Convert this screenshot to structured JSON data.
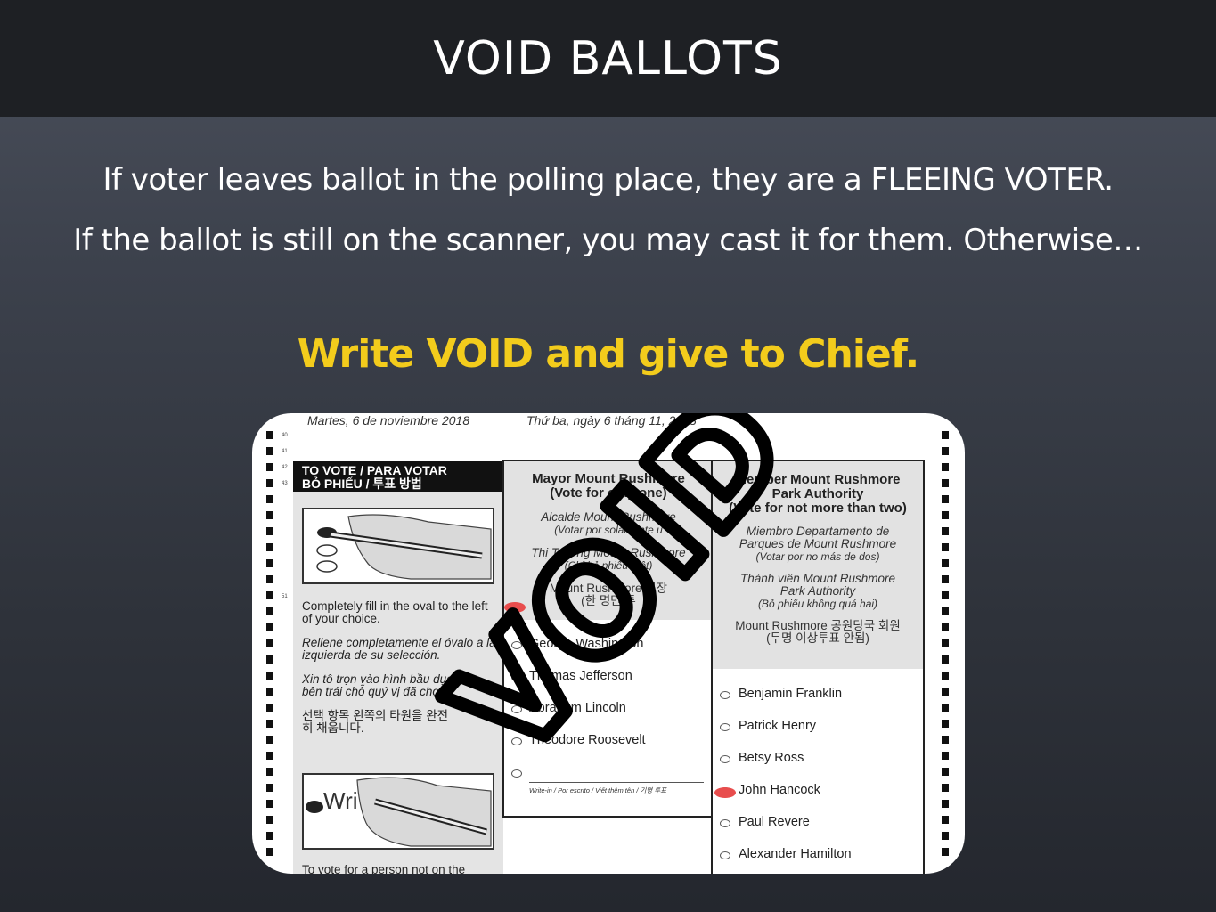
{
  "slide": {
    "title": "VOID BALLOTS",
    "line1": "If voter leaves ballot in the polling place, they are a FLEEING VOTER.",
    "line2": "If the ballot is still on the scanner, you may cast it for them. Otherwise…",
    "callout": "Write VOID and give to Chief.",
    "callout_color": "#f3cc1c"
  },
  "ballot": {
    "date_es": "Martes, 6 de noviembre 2018",
    "date_vi": "Thứ ba, ngày 6 tháng 11, 2018",
    "line_numbers": [
      "40",
      "41",
      "42",
      "43",
      "51"
    ],
    "instructions": {
      "header_line1": "TO VOTE / PARA VOTAR",
      "header_line2": "BỎ PHIẾU / 투표 방법",
      "en": "Completely fill in the oval to the left of your choice.",
      "es": "Rellene completamente el óvalo a la izquierda de su selección.",
      "vi": "Xin tô trọn vào hình bầu dục nằm bên trái chỗ quý vị đã chọ",
      "ko": "선택 항목 왼쪽의 타원을 완전히 채웁니다.",
      "writein_illustration_text": "Wri",
      "footer": "To vote for a person not on the"
    },
    "mayor": {
      "title": "Mayor Mount Rushmore",
      "instruction": "(Vote for only one)",
      "title_es": "Alcalde Mount Rushmore",
      "instruction_es": "(Votar por solamente u",
      "title_vi": "Thị Trưởng Mount Rushmore",
      "instruction_vi": "(Chỉ bỏ phiếu một)",
      "title_ko": "Mount Rushmore 시장",
      "instruction_ko": "(한 명만 투",
      "candidates": [
        "George Washington",
        "Thomas Jefferson",
        "Abraham Lincoln",
        "Theodore Roosevelt"
      ],
      "writein_label": "Write-in / Por escrito / Viết thêm tên / 기명 투표"
    },
    "park": {
      "title_line1": "Member Mount Rushmore",
      "title_line2": "Park Authority",
      "instruction": "(Vote for not more than two)",
      "title_es_line1": "Miembro Departamento de",
      "title_es_line2": "Parques de Mount Rushmore",
      "instruction_es": "(Votar por no más de dos)",
      "title_vi_line1": "Thành viên Mount Rushmore",
      "title_vi_line2": "Park Authority",
      "instruction_vi": "(Bỏ phiếu không quá hai)",
      "title_ko": "Mount Rushmore 공원당국 회원",
      "instruction_ko": "(두명 이상투표 안됨)",
      "candidates": [
        "Benjamin Franklin",
        "Patrick Henry",
        "Betsy Ross",
        "John Hancock",
        "Paul Revere",
        "Alexander Hamilton"
      ]
    },
    "void_text": "VOID",
    "mark_color": "#e84d4d"
  }
}
